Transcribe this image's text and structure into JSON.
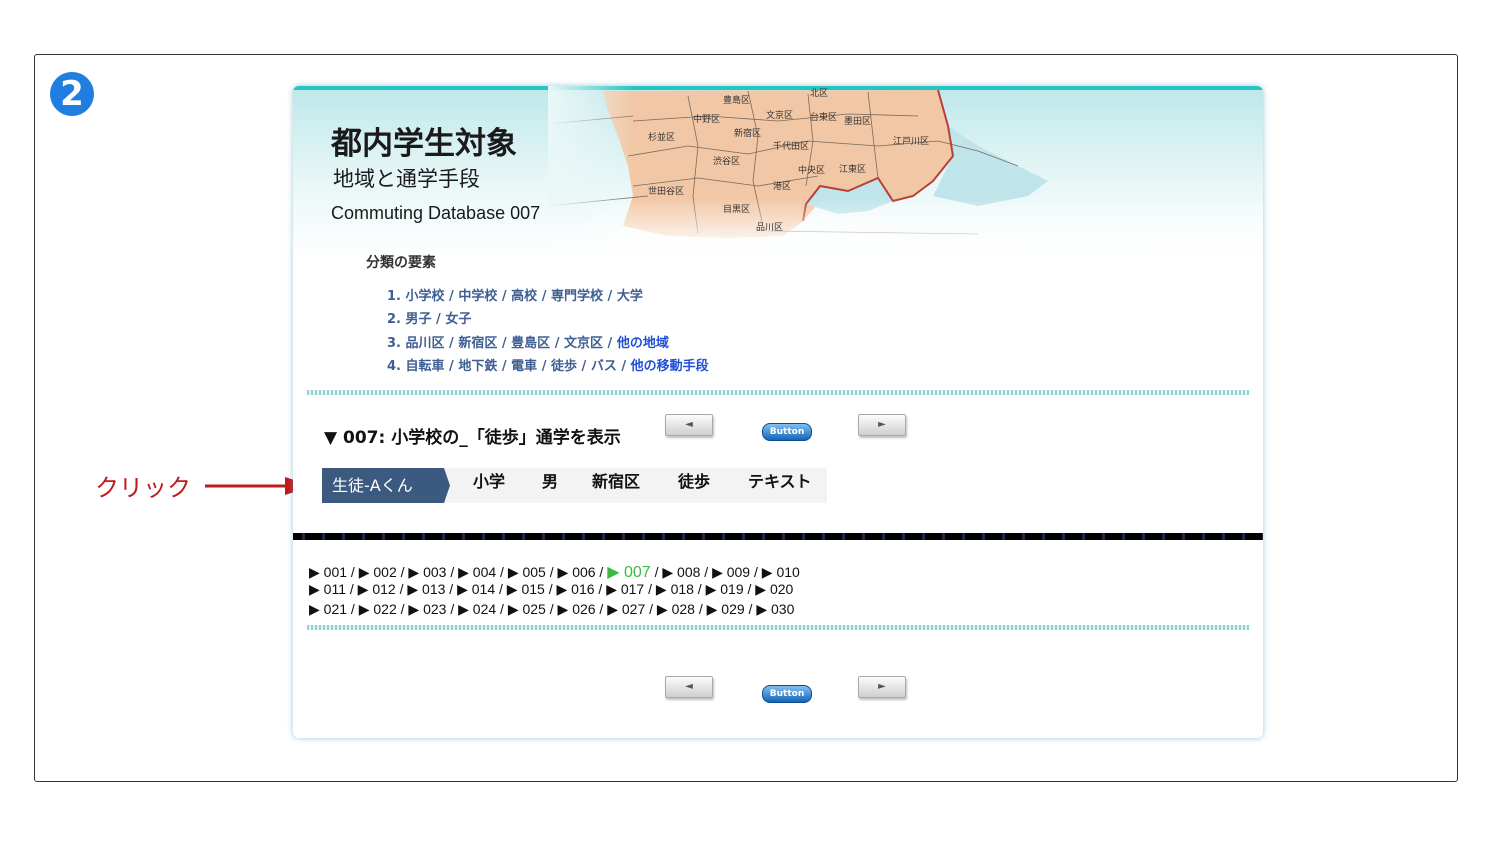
{
  "step_badge": "2",
  "annotation": {
    "label": "クリック"
  },
  "header": {
    "title": "都内学生対象",
    "subtitle": "地域と通学手段",
    "english_title": "Commuting Database 007"
  },
  "map": {
    "labels": [
      "豊島区",
      "北区",
      "中野区",
      "文京区",
      "台東区",
      "墨田区",
      "杉並区",
      "新宿区",
      "江戸川区",
      "千代田区",
      "渋谷区",
      "中央区",
      "江東区",
      "世田谷区",
      "港区",
      "目黒区",
      "品川区"
    ],
    "colors": {
      "land": "#f2c7a5",
      "water": "#bfe4ea",
      "border": "#b5413a"
    }
  },
  "categories": {
    "heading": "分類の要素",
    "items": [
      {
        "num": "1.",
        "options": [
          "小学校",
          "中学校",
          "高校",
          "専門学校",
          "大学"
        ]
      },
      {
        "num": "2.",
        "options": [
          "男子",
          "女子"
        ]
      },
      {
        "num": "3.",
        "options": [
          "品川区",
          "新宿区",
          "豊島区",
          "文京区"
        ],
        "link": "他の地域"
      },
      {
        "num": "4.",
        "options": [
          "自転車",
          "地下鉄",
          "電車",
          "徒歩",
          "バス"
        ],
        "link": "他の移動手段"
      }
    ]
  },
  "section": {
    "title": "▼ 007: 小学校の_「徒歩」通学を表示"
  },
  "buttons": {
    "prev": "◄",
    "next": "►",
    "center": "Button"
  },
  "tabs": {
    "active": "生徒-Aくん",
    "items": [
      "小学",
      "男",
      "新宿区",
      "徒歩",
      "テキスト"
    ]
  },
  "pages": {
    "current": "007",
    "marker": "▶",
    "separator": " / ",
    "rows": [
      [
        "001",
        "002",
        "003",
        "004",
        "005",
        "006",
        "007",
        "008",
        "009",
        "010"
      ],
      [
        "011",
        "012",
        "013",
        "014",
        "015",
        "016",
        "017",
        "018",
        "019",
        "020"
      ],
      [
        "021",
        "022",
        "023",
        "024",
        "025",
        "026",
        "027",
        "028",
        "029",
        "030"
      ]
    ]
  },
  "colors": {
    "accent": "#27c4c4",
    "tab_active": "#3c5a80",
    "link": "#3e5f93",
    "current_page": "#3dbb3d",
    "annotation": "#c01a1a"
  }
}
